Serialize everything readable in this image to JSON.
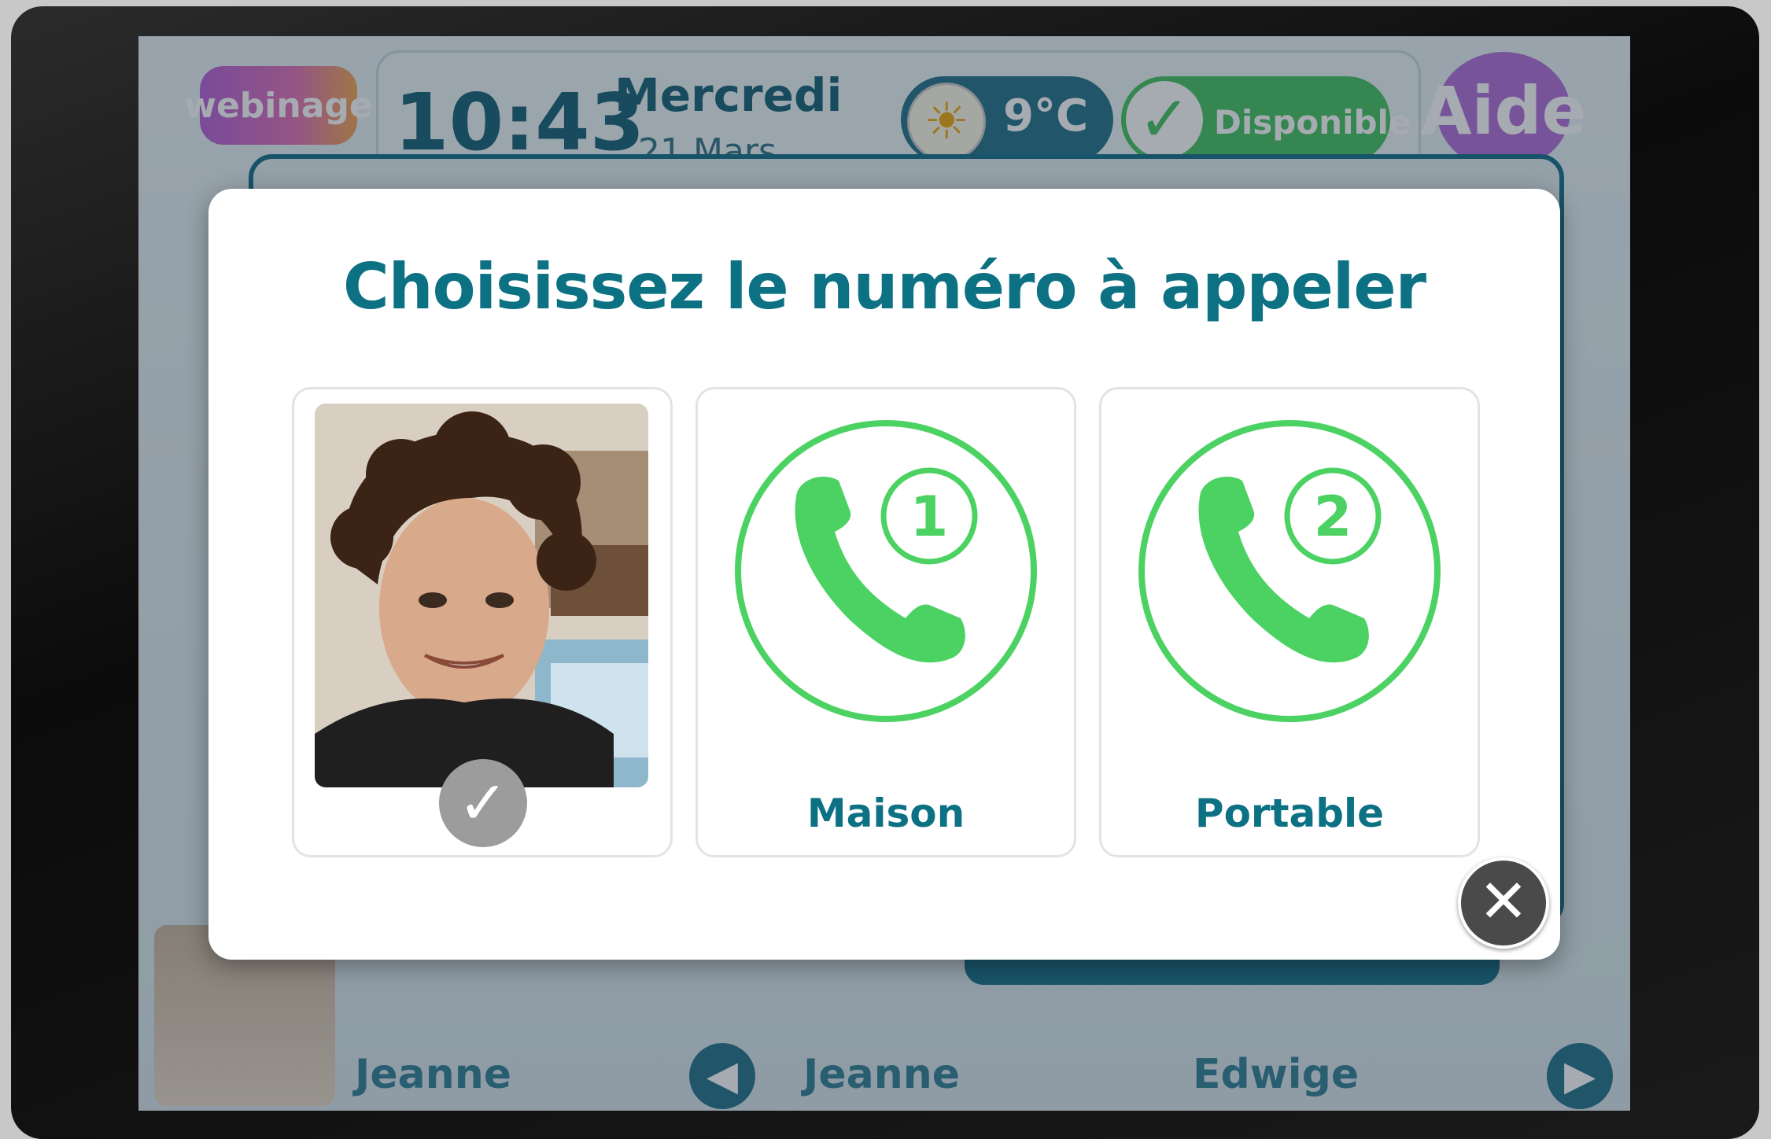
{
  "header": {
    "logo": "webinage",
    "time": "10:43",
    "day": "Mercredi",
    "date": "21 Mars",
    "temperature": "9°C",
    "status": "Disponible",
    "help": "Aide"
  },
  "contacts_bar": {
    "current_name": "Jeanne",
    "carousel": [
      "Jeanne",
      "Edwige"
    ]
  },
  "modal": {
    "title": "Choisissez le numéro à appeler",
    "options": [
      {
        "id": "photo",
        "label": "",
        "selected": true
      },
      {
        "id": "home",
        "label": "Maison",
        "number_badge": "1",
        "icon": "phone-icon"
      },
      {
        "id": "mobile",
        "label": "Portable",
        "number_badge": "2",
        "icon": "phone-icon"
      }
    ],
    "close_symbol": "✕"
  },
  "colors": {
    "accent": "#0d7184",
    "phone_green": "#4cd263",
    "status_green": "#3fbf5a",
    "close_grey": "#4a4a4a"
  }
}
